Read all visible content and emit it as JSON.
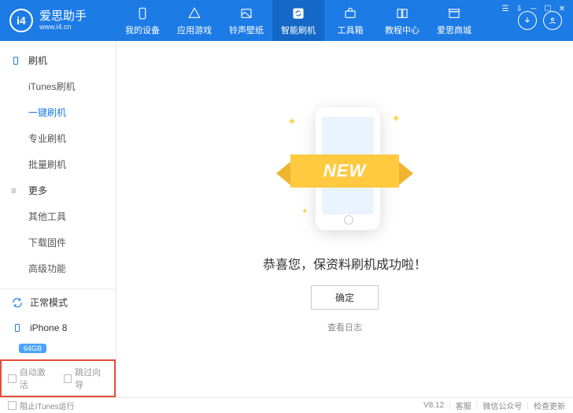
{
  "brand": {
    "logo_letters": "i4",
    "name": "爱思助手",
    "url": "www.i4.cn"
  },
  "nav": [
    {
      "label": "我的设备"
    },
    {
      "label": "应用游戏"
    },
    {
      "label": "铃声壁纸"
    },
    {
      "label": "智能刷机"
    },
    {
      "label": "工具箱"
    },
    {
      "label": "教程中心"
    },
    {
      "label": "爱思商城"
    }
  ],
  "sidebar": {
    "group1": {
      "title": "刷机",
      "items": [
        "iTunes刷机",
        "一键刷机",
        "专业刷机",
        "批量刷机"
      ]
    },
    "group2": {
      "title": "更多",
      "items": [
        "其他工具",
        "下载固件",
        "高级功能"
      ]
    },
    "mode": "正常模式",
    "device": {
      "name": "iPhone 8",
      "storage": "64GB"
    },
    "opts": {
      "auto_activate": "自动激活",
      "skip_guide": "跳过向导"
    }
  },
  "main": {
    "ribbon": "NEW",
    "success": "恭喜您，保资料刷机成功啦！",
    "ok": "确定",
    "log": "查看日志"
  },
  "footer": {
    "block_itunes": "阻止iTunes运行",
    "version": "V8.12",
    "support": "客服",
    "wechat": "微信公众号",
    "update": "检查更新"
  }
}
